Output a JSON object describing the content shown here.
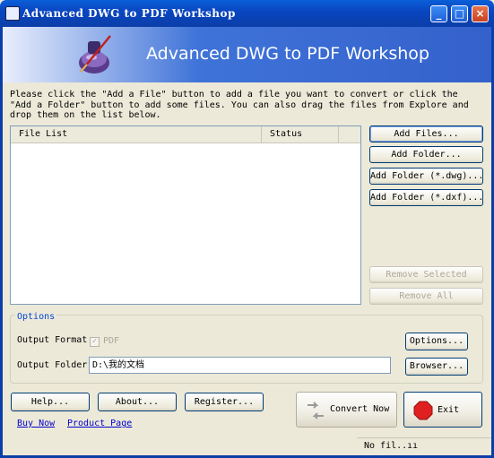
{
  "window": {
    "title": "Advanced DWG to PDF Workshop",
    "controls": [
      "_",
      "□",
      "×"
    ]
  },
  "banner": {
    "title": "Advanced DWG to PDF Workshop"
  },
  "instructions": "Please click the \"Add a File\" button to add a file you want to convert or click the\n\"Add a Folder\" button to add some files. You can also drag the files from Explore and\ndrop them on the list below.",
  "file_list": {
    "columns": [
      "File List",
      "Status"
    ],
    "rows": []
  },
  "side_buttons": {
    "add_files": "Add Files...",
    "add_folder": "Add Folder...",
    "add_folder_dwg": "Add Folder (*.dwg)...",
    "add_folder_dxf": "Add Folder (*.dxf)...",
    "remove_selected": "Remove Selected",
    "remove_all": "Remove All"
  },
  "options": {
    "group_label": "Options",
    "output_format_label": "Output Format",
    "output_format_value": "PDF",
    "output_format_checked": true,
    "options_button": "Options...",
    "output_folder_label": "Output Folder",
    "output_folder_value": "D:\\我的文档",
    "browser_button": "Browser..."
  },
  "bottom": {
    "help": "Help...",
    "about": "About...",
    "register": "Register...",
    "convert_now": "Convert Now",
    "exit": "Exit",
    "buy_now": "Buy Now",
    "product_page": "Product Page"
  },
  "status_bar": {
    "text": "No fil..ıı"
  },
  "colors": {
    "title_bar": "#0a46c2",
    "banner": "#3f73d8",
    "link": "#0000cc",
    "exit_icon": "#e02020"
  }
}
